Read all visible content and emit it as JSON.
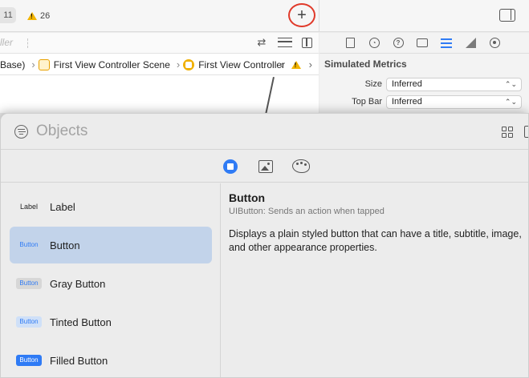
{
  "toolbar": {
    "error_count": "11",
    "warning_count": "26",
    "add_button_label": "+"
  },
  "editor": {
    "controller_ghost": "ller",
    "breadcrumbs": [
      {
        "label": "Base)"
      },
      {
        "label": "First View Controller Scene"
      },
      {
        "label": "First View Controller"
      }
    ]
  },
  "inspector": {
    "section_title": "Simulated Metrics",
    "rows": [
      {
        "label": "Size",
        "value": "Inferred"
      },
      {
        "label": "Top Bar",
        "value": "Inferred"
      }
    ]
  },
  "library": {
    "title_placeholder": "Objects",
    "items": [
      {
        "thumb": "Label",
        "name": "Label"
      },
      {
        "thumb": "Button",
        "name": "Button"
      },
      {
        "thumb": "Button",
        "name": "Gray Button"
      },
      {
        "thumb": "Button",
        "name": "Tinted Button"
      },
      {
        "thumb": "Button",
        "name": "Filled Button"
      }
    ],
    "selected_index": 1,
    "detail": {
      "title": "Button",
      "subtitle": "UIButton: Sends an action when tapped",
      "description": "Displays a plain styled button that can have a title, subtitle, image, and other appearance properties."
    }
  },
  "colors": {
    "accent": "#2f7bf5",
    "highlight_ring": "#e03a2a",
    "selection": "#c2d3ea",
    "warning": "#f2b400"
  }
}
